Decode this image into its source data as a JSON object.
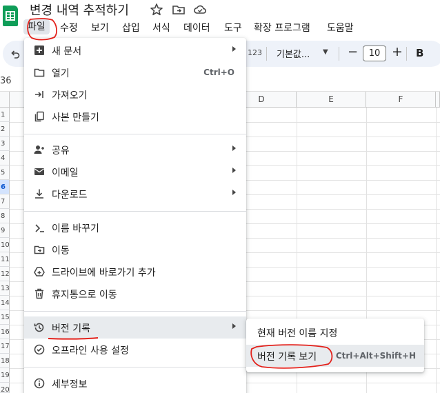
{
  "app": {
    "title": "변경 내역 추적하기",
    "title_icons": [
      "star-icon",
      "move-to-folder-icon",
      "cloud-status-icon"
    ]
  },
  "menubar": {
    "items": [
      {
        "label": "파일",
        "active": true
      },
      {
        "label": "수정"
      },
      {
        "label": "보기"
      },
      {
        "label": "삽입"
      },
      {
        "label": "서식"
      },
      {
        "label": "데이터"
      },
      {
        "label": "도구"
      },
      {
        "label": "확장 프로그램"
      },
      {
        "label": "도움말"
      }
    ]
  },
  "toolbar": {
    "number_format": "123",
    "font_name": "기본값...",
    "font_size": "10",
    "minus_label": "−",
    "plus_label": "+",
    "bold_label": "B"
  },
  "namebox": "36",
  "grid": {
    "columns": [
      "D",
      "E",
      "F"
    ],
    "rows": [
      "1",
      "2",
      "3",
      "4",
      "5",
      "6",
      "7",
      "8",
      "9",
      "10",
      "11",
      "12",
      "13",
      "14",
      "15",
      "16",
      "17",
      "18",
      "19",
      "20"
    ],
    "selected_row": "6"
  },
  "file_menu": {
    "items": [
      {
        "icon": "new-document-icon",
        "label": "새 문서",
        "submenu": true
      },
      {
        "icon": "folder-open-icon",
        "label": "열기",
        "shortcut": "Ctrl+O"
      },
      {
        "icon": "import-icon",
        "label": "가져오기"
      },
      {
        "icon": "copy-icon",
        "label": "사본 만들기"
      },
      {
        "icon": "share-icon",
        "label": "공유",
        "submenu": true
      },
      {
        "icon": "email-icon",
        "label": "이메일",
        "submenu": true
      },
      {
        "icon": "download-icon",
        "label": "다운로드",
        "submenu": true
      },
      {
        "icon": "rename-icon",
        "label": "이름 바꾸기"
      },
      {
        "icon": "move-icon",
        "label": "이동"
      },
      {
        "icon": "drive-shortcut-icon",
        "label": "드라이브에 바로가기 추가"
      },
      {
        "icon": "trash-icon",
        "label": "휴지통으로 이동"
      },
      {
        "icon": "version-history-icon",
        "label": "버전 기록",
        "submenu": true,
        "highlighted": true
      },
      {
        "icon": "offline-icon",
        "label": "오프라인 사용 설정"
      },
      {
        "icon": "info-icon",
        "label": "세부정보"
      }
    ]
  },
  "version_submenu": {
    "items": [
      {
        "label": "현재 버전 이름 지정"
      },
      {
        "label": "버전 기록 보기",
        "shortcut": "Ctrl+Alt+Shift+H",
        "highlighted": true
      }
    ]
  },
  "colors": {
    "accent_red_annotation": "#e3211b",
    "sheets_green": "#0f9d58",
    "menu_highlight": "#e8ebee",
    "toolbar_bg": "#eef2f9"
  }
}
